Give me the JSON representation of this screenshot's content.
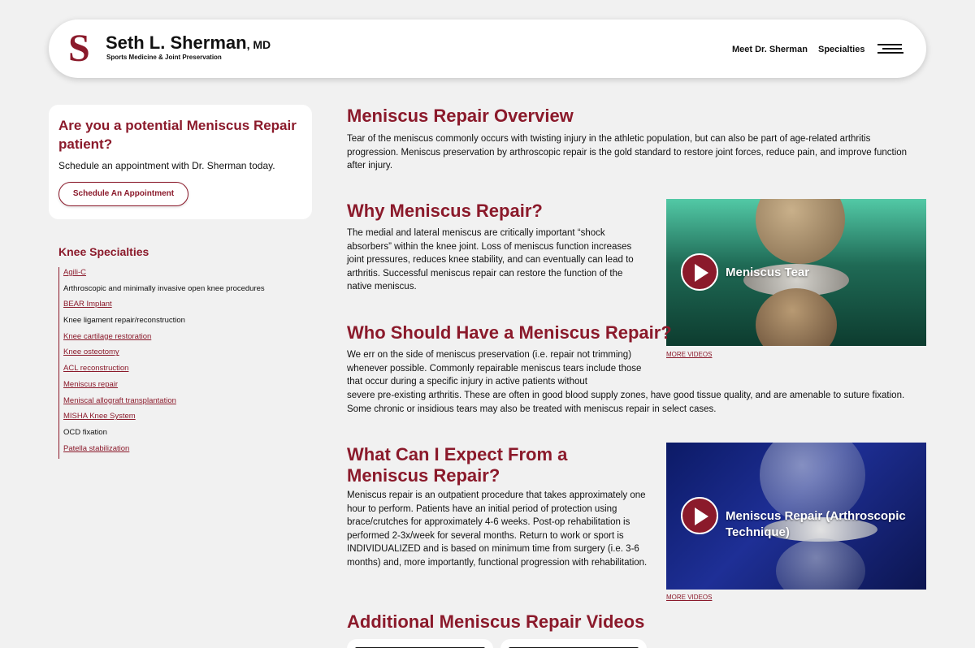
{
  "header": {
    "logo_letter": "S",
    "name": "Seth L. Sherman",
    "credential": ", MD",
    "tagline": "Sports Medicine & Joint Preservation",
    "nav": [
      {
        "label": "Meet Dr. Sherman"
      },
      {
        "label": "Specialties"
      }
    ],
    "menu_icon": "hamburger-icon"
  },
  "sidebar": {
    "cta": {
      "title": "Are you a potential Meniscus Repair patient?",
      "text": "Schedule an appointment with Dr. Sherman today.",
      "button": "Schedule An Appointment"
    },
    "specialties_title": "Knee Specialties",
    "specialties": [
      {
        "label": "Agili-C",
        "link": true
      },
      {
        "label": "Arthroscopic and minimally invasive open knee procedures",
        "link": false
      },
      {
        "label": "BEAR Implant",
        "link": true
      },
      {
        "label": "Knee ligament repair/reconstruction",
        "link": false
      },
      {
        "label": "Knee cartilage restoration",
        "link": true
      },
      {
        "label": "Knee osteotomy",
        "link": true
      },
      {
        "label": "ACL reconstruction",
        "link": true
      },
      {
        "label": "Meniscus repair",
        "link": true
      },
      {
        "label": "Meniscal allograft transplantation",
        "link": true
      },
      {
        "label": "MISHA Knee System",
        "link": true
      },
      {
        "label": "OCD fixation",
        "link": false
      },
      {
        "label": "Patella stabilization",
        "link": true
      }
    ]
  },
  "main": {
    "overview_title": "Meniscus Repair Overview",
    "overview_text": "Tear of the meniscus commonly occurs with twisting injury in the athletic population, but can also be part of age-related arthritis progression. Meniscus preservation by arthroscopic repair is the gold standard to restore joint forces, reduce pain, and improve function after injury.",
    "why_title": "Why Meniscus Repair?",
    "why_text": "The medial and lateral meniscus are critically important “shock absorbers” within the knee joint. Loss of meniscus function increases joint pressures, reduces knee stability, and can eventually can lead to arthritis. Successful meniscus repair can restore the function of the native meniscus.",
    "who_title": "Who Should Have a Meniscus Repair?",
    "who_text_1": "We err on the side of meniscus preservation (i.e. repair not trimming) whenever possible. Commonly repairable meniscus tears include those that occur during a specific injury in active patients without",
    "who_text_2": "severe pre-existing arthritis. These are often in good blood supply zones, have good tissue quality, and are amenable to suture fixation. Some chronic or insidious tears may also be treated with meniscus repair in select cases.",
    "expect_title": "What Can I Expect From a Meniscus Repair?",
    "expect_text": "Meniscus repair is an outpatient procedure that takes approximately one hour to perform. Patients have an initial period of protection using brace/crutches for approximately 4-6 weeks. Post-op rehabilitation is performed 2-3x/week for several months. Return to work or sport is INDIVIDUALIZED and is based on minimum time from surgery (i.e. 3-6 months) and, more importantly, functional progression with rehabilitation.",
    "additional_title": "Additional Meniscus Repair Videos",
    "videos": [
      {
        "title": "Meniscus Tear",
        "more": "MORE VIDEOS",
        "play_icon": "play-icon"
      },
      {
        "title": "Meniscus Repair (Arthroscopic Technique)",
        "more": "MORE VIDEOS",
        "play_icon": "play-icon"
      }
    ]
  },
  "colors": {
    "brand": "#8b1a2b",
    "background": "#f1f1f1",
    "video_1": "#1f6a55",
    "video_2": "#1e2f96"
  }
}
